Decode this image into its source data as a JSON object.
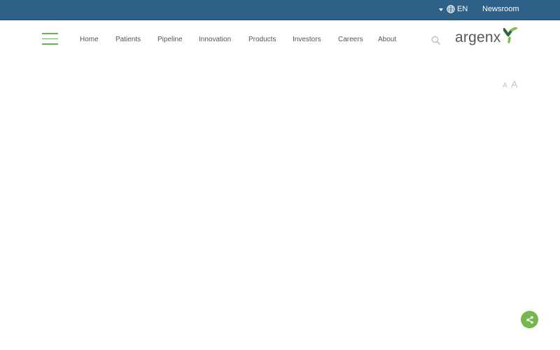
{
  "topbar": {
    "language": "EN",
    "newsroom": "Newsroom"
  },
  "nav": {
    "items": [
      "Home",
      "Patients",
      "Pipeline",
      "Innovation",
      "Products",
      "Investors",
      "Careers",
      "About"
    ]
  },
  "logo": {
    "text": "argenx"
  },
  "font_size_control": {
    "small": "A",
    "large": "A"
  },
  "icons": {
    "menu": "hamburger-icon",
    "globe": "globe-icon",
    "search": "search-icon",
    "share": "share-icon"
  },
  "colors": {
    "topbar": "#2e6187",
    "accent_green": "#6ab04c",
    "nav_text": "#555555"
  }
}
